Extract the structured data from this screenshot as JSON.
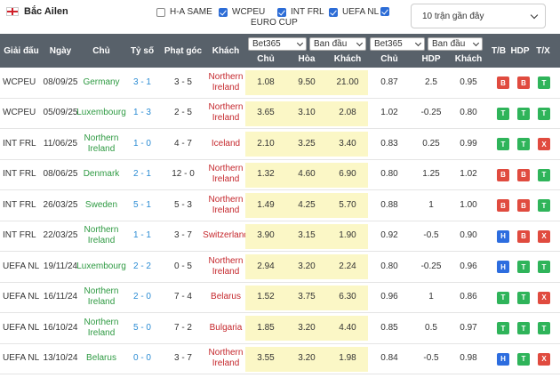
{
  "team": {
    "name": "Bắc Ailen"
  },
  "filters": [
    {
      "label": "H-A SAME",
      "checked": false
    },
    {
      "label": "WCPEU",
      "checked": true
    },
    {
      "label": "INT FRL",
      "checked": true
    },
    {
      "label": "UEFA NL",
      "checked": true
    },
    {
      "label": "EURO CUP",
      "checked": true
    }
  ],
  "last_select": {
    "value": "10 trận gần đây"
  },
  "header": {
    "league": "Giải đấu",
    "date": "Ngày",
    "home": "Chủ",
    "score": "Tỷ số",
    "corner": "Phạt góc",
    "away": "Khách",
    "book1": "Bet365",
    "type1": "Ban đầu",
    "book2": "Bet365",
    "type2": "Ban đầu",
    "o_home": "Chủ",
    "o_draw": "Hòa",
    "o_away": "Khách",
    "h_home": "Chủ",
    "h_hdp": "HDP",
    "h_away": "Khách",
    "tb": "T/B",
    "hdp": "HDP",
    "tx": "T/X"
  },
  "colors": {
    "red": "#e04b3f",
    "green": "#2fb45a",
    "blue": "#2d6ddf",
    "header": "#58616a",
    "odds_bg": "#fbf7c6"
  },
  "rows": [
    {
      "league": "WCPEU",
      "date": "08/09/25",
      "home": "Germany",
      "home_color": "green",
      "score": "3 - 1",
      "corner": "3 - 5",
      "away": "Northern Ireland",
      "away_color": "red",
      "o1": "1.08",
      "o2": "9.50",
      "o3": "21.00",
      "h1": "0.87",
      "h2": "2.5",
      "h3": "0.95",
      "b1": "B",
      "b1c": "red",
      "b2": "B",
      "b2c": "red",
      "b3": "T",
      "b3c": "green"
    },
    {
      "league": "WCPEU",
      "date": "05/09/25",
      "home": "Luxembourg",
      "home_color": "green",
      "score": "1 - 3",
      "corner": "2 - 5",
      "away": "Northern Ireland",
      "away_color": "red",
      "o1": "3.65",
      "o2": "3.10",
      "o3": "2.08",
      "h1": "1.02",
      "h2": "-0.25",
      "h3": "0.80",
      "b1": "T",
      "b1c": "green",
      "b2": "T",
      "b2c": "green",
      "b3": "T",
      "b3c": "green"
    },
    {
      "league": "INT FRL",
      "date": "11/06/25",
      "home": "Northern Ireland",
      "home_color": "green",
      "score": "1 - 0",
      "corner": "4 - 7",
      "away": "Iceland",
      "away_color": "red",
      "o1": "2.10",
      "o2": "3.25",
      "o3": "3.40",
      "h1": "0.83",
      "h2": "0.25",
      "h3": "0.99",
      "b1": "T",
      "b1c": "green",
      "b2": "T",
      "b2c": "green",
      "b3": "X",
      "b3c": "red"
    },
    {
      "league": "INT FRL",
      "date": "08/06/25",
      "home": "Denmark",
      "home_color": "green",
      "score": "2 - 1",
      "corner": "12 - 0",
      "away": "Northern Ireland",
      "away_color": "red",
      "o1": "1.32",
      "o2": "4.60",
      "o3": "6.90",
      "h1": "0.80",
      "h2": "1.25",
      "h3": "1.02",
      "b1": "B",
      "b1c": "red",
      "b2": "B",
      "b2c": "red",
      "b3": "T",
      "b3c": "green"
    },
    {
      "league": "INT FRL",
      "date": "26/03/25",
      "home": "Sweden",
      "home_color": "green",
      "score": "5 - 1",
      "corner": "5 - 3",
      "away": "Northern Ireland",
      "away_color": "red",
      "o1": "1.49",
      "o2": "4.25",
      "o3": "5.70",
      "h1": "0.88",
      "h2": "1",
      "h3": "1.00",
      "b1": "B",
      "b1c": "red",
      "b2": "B",
      "b2c": "red",
      "b3": "T",
      "b3c": "green"
    },
    {
      "league": "INT FRL",
      "date": "22/03/25",
      "home": "Northern Ireland",
      "home_color": "green",
      "score": "1 - 1",
      "corner": "3 - 7",
      "away": "Switzerland",
      "away_color": "red",
      "o1": "3.90",
      "o2": "3.15",
      "o3": "1.90",
      "h1": "0.92",
      "h2": "-0.5",
      "h3": "0.90",
      "b1": "H",
      "b1c": "blue",
      "b2": "B",
      "b2c": "red",
      "b3": "X",
      "b3c": "red"
    },
    {
      "league": "UEFA NL",
      "date": "19/11/24",
      "home": "Luxembourg",
      "home_color": "green",
      "score": "2 - 2",
      "corner": "0 - 5",
      "away": "Northern Ireland",
      "away_color": "red",
      "o1": "2.94",
      "o2": "3.20",
      "o3": "2.24",
      "h1": "0.80",
      "h2": "-0.25",
      "h3": "0.96",
      "b1": "H",
      "b1c": "blue",
      "b2": "T",
      "b2c": "green",
      "b3": "T",
      "b3c": "green"
    },
    {
      "league": "UEFA NL",
      "date": "16/11/24",
      "home": "Northern Ireland",
      "home_color": "green",
      "score": "2 - 0",
      "corner": "7 - 4",
      "away": "Belarus",
      "away_color": "red",
      "o1": "1.52",
      "o2": "3.75",
      "o3": "6.30",
      "h1": "0.96",
      "h2": "1",
      "h3": "0.86",
      "b1": "T",
      "b1c": "green",
      "b2": "T",
      "b2c": "green",
      "b3": "X",
      "b3c": "red"
    },
    {
      "league": "UEFA NL",
      "date": "16/10/24",
      "home": "Northern Ireland",
      "home_color": "green",
      "score": "5 - 0",
      "corner": "7 - 2",
      "away": "Bulgaria",
      "away_color": "red",
      "o1": "1.85",
      "o2": "3.20",
      "o3": "4.40",
      "h1": "0.85",
      "h2": "0.5",
      "h3": "0.97",
      "b1": "T",
      "b1c": "green",
      "b2": "T",
      "b2c": "green",
      "b3": "T",
      "b3c": "green"
    },
    {
      "league": "UEFA NL",
      "date": "13/10/24",
      "home": "Belarus",
      "home_color": "green",
      "score": "0 - 0",
      "corner": "3 - 7",
      "away": "Northern Ireland",
      "away_color": "red",
      "o1": "3.55",
      "o2": "3.20",
      "o3": "1.98",
      "h1": "0.84",
      "h2": "-0.5",
      "h3": "0.98",
      "b1": "H",
      "b1c": "blue",
      "b2": "T",
      "b2c": "green",
      "b3": "X",
      "b3c": "red"
    }
  ]
}
